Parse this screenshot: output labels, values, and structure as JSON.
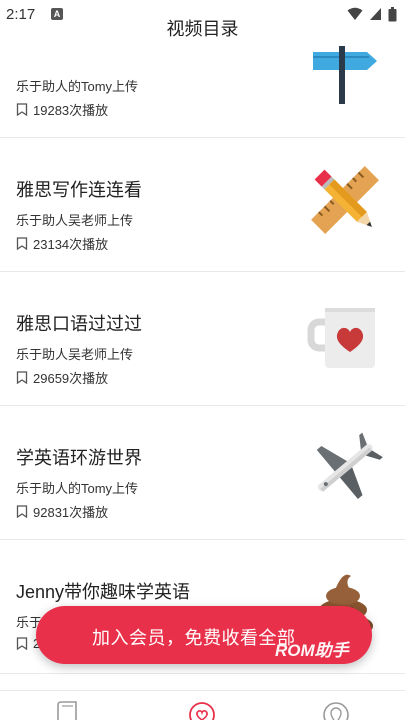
{
  "status_bar": {
    "time": "2:17",
    "notification_badge": "A",
    "icons": [
      "wifi-icon",
      "signal-icon",
      "battery-icon"
    ]
  },
  "header": {
    "title": "视频目录"
  },
  "videos": [
    {
      "title": "",
      "uploader": "乐于助人的Tomy上传",
      "plays": "19283次播放",
      "thumbnail": "signpost-icon"
    },
    {
      "title": "雅思写作连连看",
      "uploader": "乐于助人吴老师上传",
      "plays": "23134次播放",
      "thumbnail": "pencil-ruler-icon"
    },
    {
      "title": "雅思口语过过过",
      "uploader": "乐于助人吴老师上传",
      "plays": "29659次播放",
      "thumbnail": "mug-heart-icon"
    },
    {
      "title": "学英语环游世界",
      "uploader": "乐于助人的Tomy上传",
      "plays": "92831次播放",
      "thumbnail": "airplane-icon"
    },
    {
      "title": "Jenny带你趣味学英语",
      "uploader": "乐于",
      "plays": "2",
      "thumbnail": "poop-icon"
    }
  ],
  "promo": {
    "text": "加入会员，免费收看全部",
    "watermark": "ROM助手",
    "color": "#e9304a"
  },
  "bottom_nav": {
    "items": [
      "book-icon",
      "heart-icon",
      "location-icon"
    ],
    "active_color": "#e9304a"
  }
}
